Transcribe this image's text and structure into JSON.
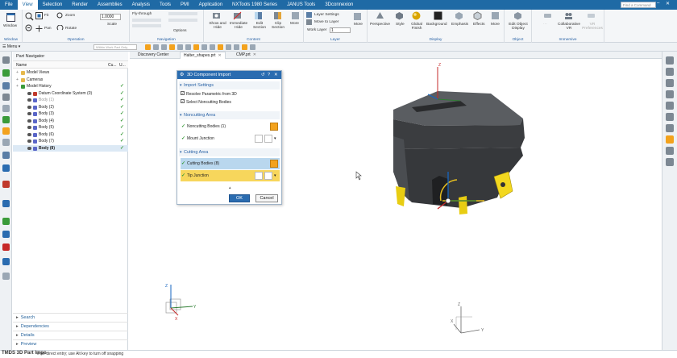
{
  "menu": {
    "items": [
      "File",
      "View",
      "Selection",
      "Render",
      "Assemblies",
      "Analysis",
      "Tools",
      "PMI",
      "Application",
      "NXTools 1980 Series",
      "JANUS Tools",
      "3Dconnexion"
    ],
    "active_index": 1,
    "search_placeholder": "Find a Command"
  },
  "ribbon": {
    "groups": {
      "window": "Window",
      "operation": "Operation",
      "navigation": "Navigation",
      "content": "Content",
      "layer": "Layer",
      "display": "Display",
      "object": "Object",
      "immersive": "Immersive"
    },
    "window_btn": "Window",
    "fit": "Fit",
    "pan": "Pan",
    "zoom": "Zoom",
    "rotate": "Rotate",
    "scale_label": "Scale",
    "scale_value": "1.0000",
    "fly_through": "Fly-through",
    "options": "Options",
    "show_hide": "Show and Hide",
    "immediate_hide": "Immediate Hide",
    "edit_section": "Edit Section",
    "clip_section": "Clip Section",
    "more": "More",
    "layer_settings": "Layer Settings",
    "move_to_layer": "Move to Layer",
    "work_layer_label": "Work Layer",
    "work_layer_value": "1",
    "perspective": "Perspective",
    "style": "Style",
    "global_finish": "Global Finish",
    "background": "Background",
    "emphasis": "Emphasis",
    "effects": "Effects",
    "edit_object_display": "Edit Object Display",
    "collaborative_vr": "Collaborative VR",
    "vr_preferences": "VR Preferences"
  },
  "toolbar2": {
    "menu": "Menu",
    "filter": "Within Work Part Only"
  },
  "navigator": {
    "title": "Part Navigator",
    "col_name": "Name",
    "col_current": "Cu...",
    "col_up": "U...",
    "rows": [
      {
        "label": "Model Views",
        "indent": 1,
        "kind": "folder"
      },
      {
        "label": "Cameras",
        "indent": 1,
        "kind": "folder"
      },
      {
        "label": "Model History",
        "indent": 1,
        "kind": "history",
        "check": "✓"
      },
      {
        "label": "Datum Coordinate System (0)",
        "indent": 2,
        "kind": "datum",
        "check": "✓"
      },
      {
        "label": "Body (1)",
        "indent": 2,
        "kind": "body",
        "check": "✓",
        "dim": true
      },
      {
        "label": "Body (2)",
        "indent": 2,
        "kind": "body",
        "check": "✓"
      },
      {
        "label": "Body (3)",
        "indent": 2,
        "kind": "body",
        "check": "✓"
      },
      {
        "label": "Body (4)",
        "indent": 2,
        "kind": "body",
        "check": "✓"
      },
      {
        "label": "Body (5)",
        "indent": 2,
        "kind": "body",
        "check": "✓"
      },
      {
        "label": "Body (6)",
        "indent": 2,
        "kind": "body",
        "check": "✓"
      },
      {
        "label": "Body (7)",
        "indent": 2,
        "kind": "body",
        "check": "✓"
      },
      {
        "label": "Body (8)",
        "indent": 2,
        "kind": "body",
        "check": "✓",
        "bold": true
      }
    ],
    "sections": [
      "Search",
      "Dependencies",
      "Details",
      "Preview"
    ]
  },
  "tabs": [
    {
      "label": "Discovery Center",
      "closable": false
    },
    {
      "label": "Halter_shapes.prt",
      "closable": true
    },
    {
      "label": "CMP.prt",
      "closable": true
    }
  ],
  "tabs_active": 1,
  "dialog": {
    "title": "3D Component Import",
    "sections": {
      "import_settings": "Import Settings",
      "noncutting_area": "Noncutting Area",
      "cutting_area": "Cutting Area"
    },
    "options": [
      {
        "label": "Resolve Parametric from 3D",
        "checked": true
      },
      {
        "label": "Select Noncutting Bodies",
        "checked": true
      }
    ],
    "noncutting_bodies": "Noncutting Bodies (1)",
    "mount_junction": "Mount Junction",
    "cutting_bodies": "Cutting Bodies (8)",
    "tip_junction": "Tip Junction",
    "ok": "OK",
    "cancel": "Cancel",
    "check_mark": "✓"
  },
  "status": {
    "text": "e for direct entry; use Alt key to turn off snapping"
  },
  "caption": "TMDS 3D Part Impo",
  "axes": {
    "x": "X",
    "y": "Y",
    "z": "Z"
  },
  "colors": {
    "accent": "#1f6aa5",
    "dialog_title": "#2a6cb0",
    "selected_blue": "#b9d7ee",
    "selected_yellow": "#f7d65c",
    "check_green": "#3a9b3a",
    "body_dark": "#3b3d40",
    "insert_yellow": "#e8cd12"
  }
}
